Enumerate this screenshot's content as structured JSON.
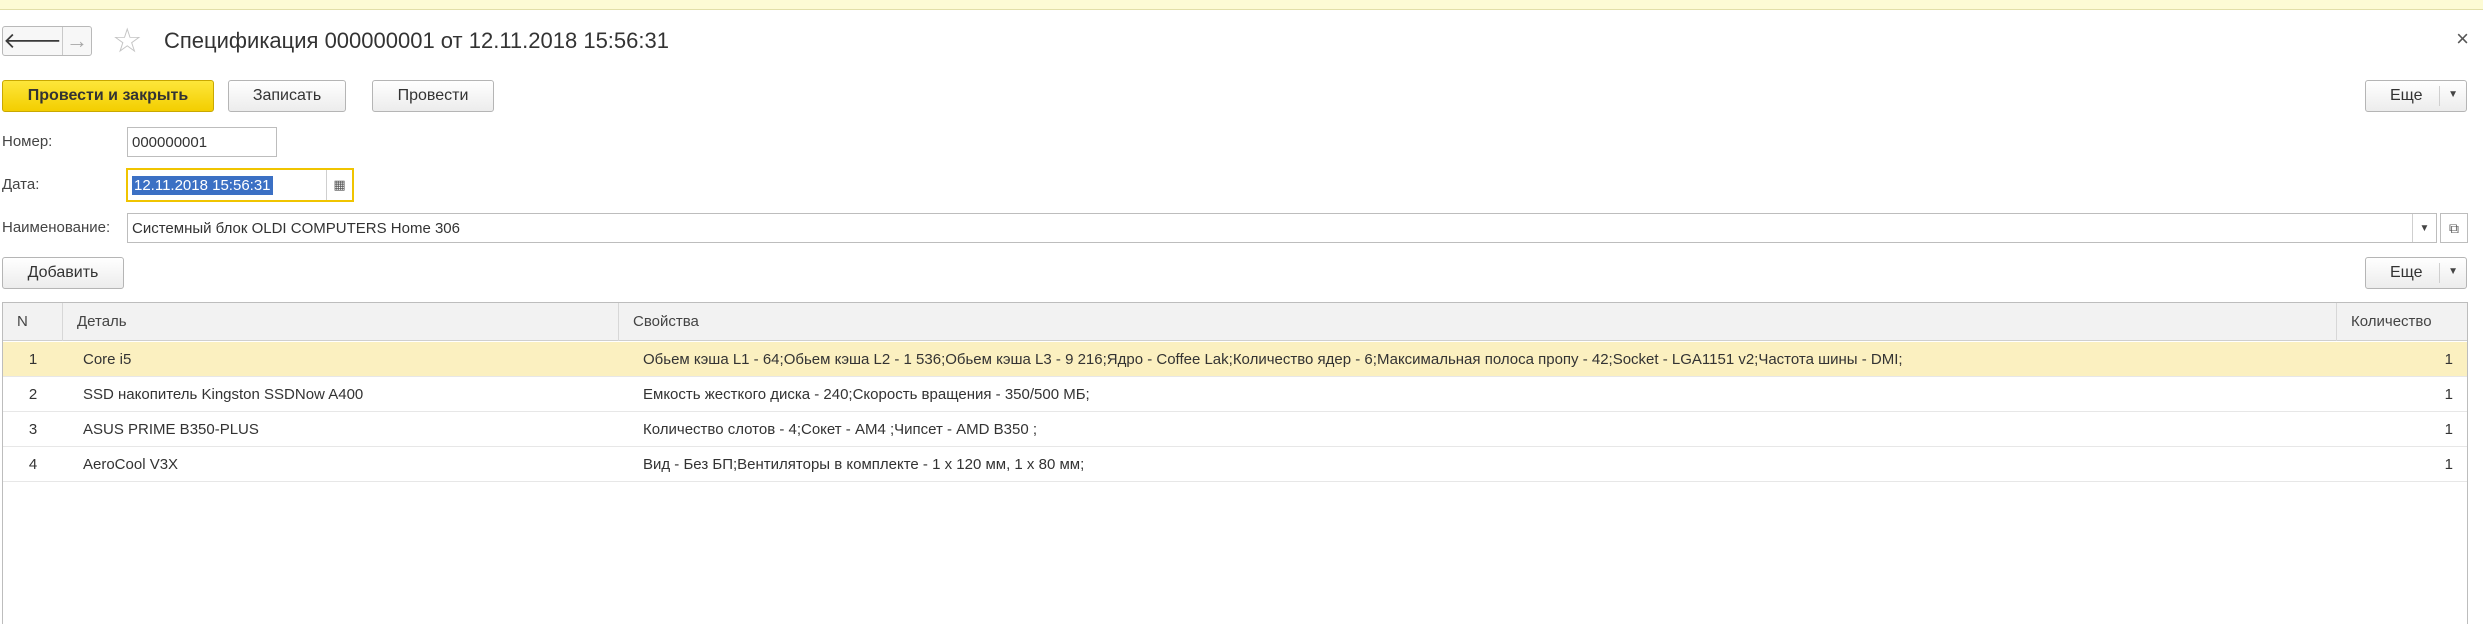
{
  "window": {
    "title": "Спецификация 000000001 от 12.11.2018 15:56:31",
    "back_icon": "arrow-left-icon",
    "forward_icon": "arrow-right-icon",
    "favorite_icon": "star-icon",
    "close_icon": "close-icon",
    "back_glyph": "🡐",
    "forward_glyph": "→",
    "star_glyph": "☆",
    "close_glyph": "×"
  },
  "toolbar": {
    "post_and_close_label": "Провести и закрыть",
    "save_label": "Записать",
    "post_label": "Провести",
    "more_label": "Еще"
  },
  "form": {
    "number_label": "Номер:",
    "number_value": "000000001",
    "date_label": "Дата:",
    "date_value": "12.11.2018 15:56:31",
    "name_label": "Наименование:",
    "name_value": "Системный блок OLDI COMPUTERS Home 306"
  },
  "table_toolbar": {
    "add_label": "Добавить",
    "more_label": "Еще"
  },
  "table": {
    "columns": [
      "N",
      "Деталь",
      "Свойства",
      "Количество"
    ],
    "rows": [
      {
        "n": "1",
        "detail": "Core i5",
        "props": "Обьем кэша L1 -  64;Обьем кэша L2 -  1 536;Обьем кэша L3 -  9 216;Ядро -  Coffee Lak;Количество ядер -  6;Максимальная полоса пропу -  42;Socket -  LGA1151 v2;Частота шины -  DMI;",
        "qty": "1"
      },
      {
        "n": "2",
        "detail": "SSD накопитель Kingston SSDNow A400",
        "props": "Емкость жесткого диска -  240;Скорость вращения -  350/500 МБ;",
        "qty": "1"
      },
      {
        "n": "3",
        "detail": "ASUS PRIME B350-PLUS",
        "props": "Количество слотов -  4;Сокет -  AM4 ;Чипсет -  AMD B350 ;",
        "qty": "1"
      },
      {
        "n": "4",
        "detail": "AeroCool V3X",
        "props": "Вид -  Без БП;Вентиляторы в комплекте -  1 x 120 мм, 1 x 80 мм;",
        "qty": "1"
      }
    ]
  },
  "colors": {
    "accent_yellow": "#f3ce00",
    "selected_row": "#fbf0c0",
    "selection_blue": "#3b70c4"
  }
}
